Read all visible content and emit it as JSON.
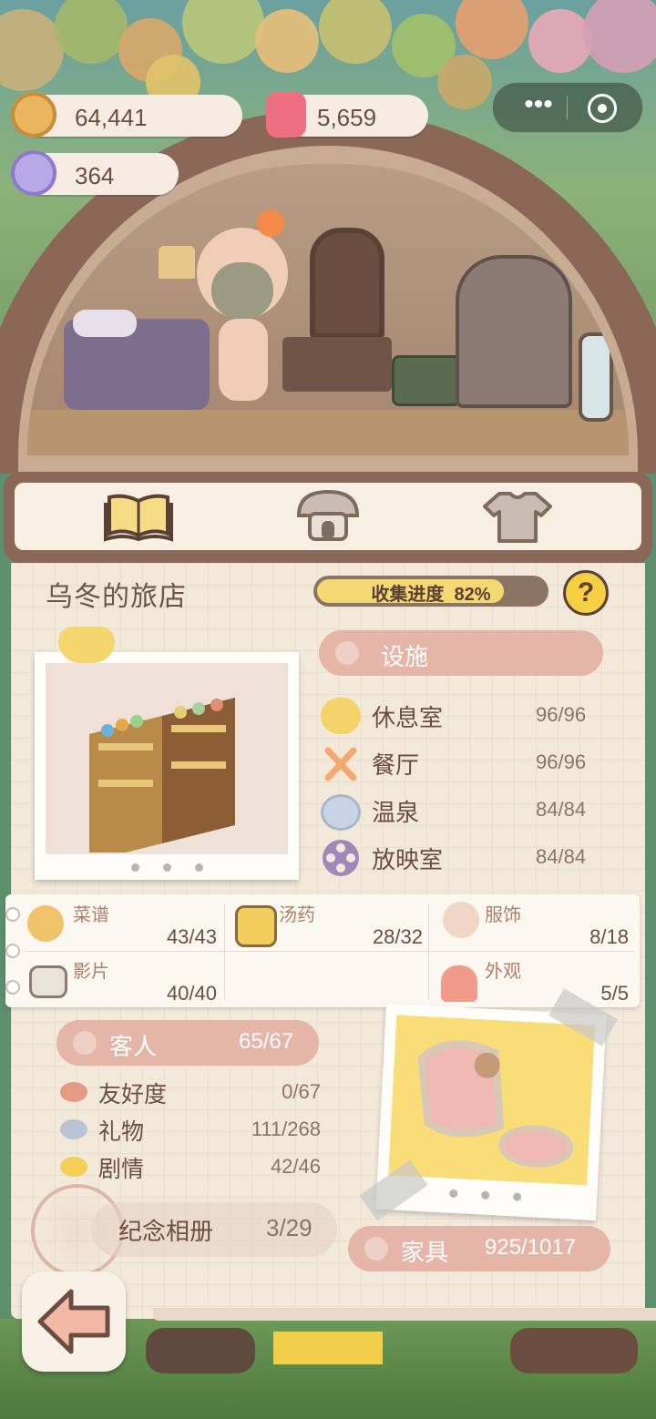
{
  "currencies": {
    "cookies": {
      "value": "64,441",
      "icon": "cookie-icon"
    },
    "candles": {
      "value": "5,659",
      "icon": "candle-icon"
    },
    "gems": {
      "value": "364",
      "icon": "gem-icon"
    }
  },
  "tabs": [
    {
      "name": "collection",
      "icon": "book-icon"
    },
    {
      "name": "hotel",
      "icon": "mushroom-house-icon"
    },
    {
      "name": "outfit",
      "icon": "shirt-icon"
    }
  ],
  "inn": {
    "title": "乌冬的旅店",
    "progress_label": "收集进度",
    "progress_value": "82%",
    "progress_fraction": 0.82,
    "help": "?"
  },
  "facilities": {
    "header": "设施",
    "items": [
      {
        "label": "休息室",
        "value": "96/96",
        "icon": "cloud-icon",
        "color": "#f6d26b"
      },
      {
        "label": "餐厅",
        "value": "96/96",
        "icon": "fork-spoon-icon",
        "color": "#f5a86d"
      },
      {
        "label": "温泉",
        "value": "84/84",
        "icon": "hot-spring-icon",
        "color": "#b7c4dc"
      },
      {
        "label": "放映室",
        "value": "84/84",
        "icon": "film-reel-icon",
        "color": "#9d8ab8"
      }
    ]
  },
  "categories": [
    {
      "label": "菜谱",
      "value": "43/43",
      "icon": "dish-icon"
    },
    {
      "label": "汤药",
      "value": "28/32",
      "icon": "potion-icon"
    },
    {
      "label": "服饰",
      "value": "8/18",
      "icon": "costume-icon"
    },
    {
      "label": "影片",
      "value": "40/40",
      "icon": "clapper-icon"
    },
    {
      "label": "外观",
      "value": "5/5",
      "icon": "house-icon"
    }
  ],
  "guests": {
    "header": "客人",
    "count": "65/67",
    "items": [
      {
        "label": "友好度",
        "value": "0/67",
        "icon": "heart-icon",
        "color": "#e59a86"
      },
      {
        "label": "礼物",
        "value": "111/268",
        "icon": "heart-icon",
        "color": "#b9c3d6"
      },
      {
        "label": "剧情",
        "value": "42/46",
        "icon": "heart-icon",
        "color": "#f3cf58"
      }
    ]
  },
  "album": {
    "label": "纪念相册",
    "value": "3/29"
  },
  "furniture": {
    "label": "家具",
    "value": "925/1017"
  }
}
